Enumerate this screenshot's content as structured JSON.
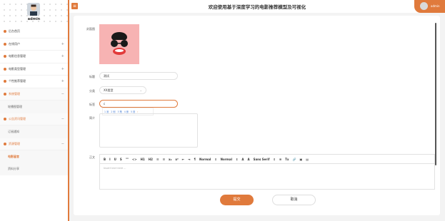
{
  "header": {
    "title": "欢迎使用基于深度学习的电影推荐模型及可视化",
    "user": "admin"
  },
  "sidebar": {
    "user_name": "admin",
    "items": [
      {
        "label": "后台首页",
        "arrow": ""
      },
      {
        "label": "在线用户",
        "arrow": "+"
      },
      {
        "label": "电影信息管理",
        "arrow": "+"
      },
      {
        "label": "电影类型管理",
        "arrow": "+"
      },
      {
        "label": "个性推荐管理",
        "arrow": "+"
      },
      {
        "label": "系统管理",
        "arrow": "−"
      },
      {
        "label": "轮播图管理",
        "arrow": "",
        "sub": true
      },
      {
        "label": "公告资讯管理",
        "arrow": "−"
      },
      {
        "label": "订阅通知",
        "arrow": "",
        "sub": true
      },
      {
        "label": "资源管理",
        "arrow": "−"
      },
      {
        "label": "电影留言",
        "arrow": "",
        "sub": true,
        "active": true
      },
      {
        "label": "资料分享",
        "arrow": "",
        "sub": true
      }
    ]
  },
  "form": {
    "poster_label": "封面图",
    "title_label": "标题",
    "title_value": "测试",
    "category_label": "分类",
    "category_value": "XX类型",
    "tags_label": "标签",
    "tags_value": "c",
    "suggestions": [
      "1 测",
      "2 侧",
      "3 策",
      "4 册",
      "5 则"
    ],
    "brief_label": "简介",
    "content_label": "正文",
    "editor_placeholder": "Insert text here ...",
    "toolbar": [
      "B",
      "I",
      "U",
      "S",
      "\"\"",
      "<>",
      "H1",
      "H2",
      "☰",
      "☰",
      "x₂",
      "x²",
      "⇤",
      "⇥",
      "¶",
      "Normal",
      "⇕",
      "Normal",
      "⇕",
      "A",
      "A",
      "Sans Serif",
      "⇕",
      "≡",
      "Tx",
      "🔗",
      "▣",
      "▤"
    ],
    "submit_label": "提交",
    "cancel_label": "取消"
  }
}
